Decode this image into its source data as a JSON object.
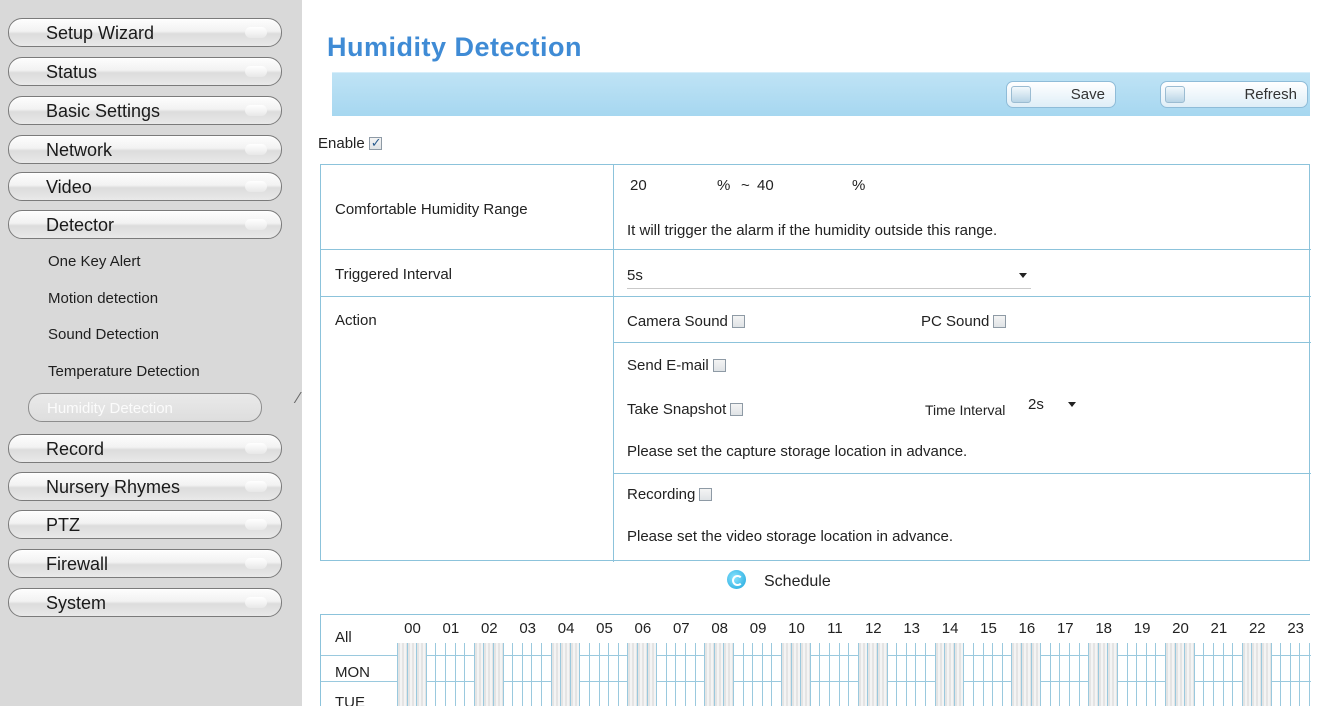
{
  "sidebar": {
    "menu": [
      {
        "label": "Setup Wizard"
      },
      {
        "label": "Status"
      },
      {
        "label": "Basic Settings"
      },
      {
        "label": "Network"
      },
      {
        "label": "Video"
      },
      {
        "label": "Detector"
      },
      {
        "label": "Record"
      },
      {
        "label": "Nursery Rhymes"
      },
      {
        "label": "PTZ"
      },
      {
        "label": "Firewall"
      },
      {
        "label": "System"
      }
    ],
    "detector_sub": [
      {
        "label": "One Key Alert"
      },
      {
        "label": "Motion detection"
      },
      {
        "label": "Sound Detection"
      },
      {
        "label": "Temperature Detection"
      },
      {
        "label": "Humidity Detection"
      }
    ],
    "active_item": "Humidity Detection"
  },
  "page": {
    "title": "Humidity Detection",
    "save_label": "Save",
    "refresh_label": "Refresh",
    "enable_label": "Enable",
    "enable_checked": true
  },
  "humidity": {
    "range_label": "Comfortable Humidity Range",
    "min_value": "20",
    "max_value": "40",
    "unit": "%",
    "separator": "~",
    "range_hint": "It will trigger the alarm if the humidity outside this range."
  },
  "interval": {
    "label": "Triggered Interval",
    "value": "5s"
  },
  "action": {
    "label": "Action",
    "camera_sound": "Camera Sound",
    "pc_sound": "PC Sound",
    "send_email": "Send E-mail",
    "take_snapshot": "Take Snapshot",
    "time_interval_label": "Time Interval",
    "time_interval_value": "2s",
    "snapshot_hint": "Please set the capture storage location in advance.",
    "recording": "Recording",
    "recording_hint": "Please set the video storage location in advance."
  },
  "schedule": {
    "title": "Schedule",
    "all_label": "All",
    "days": [
      "MON",
      "TUE"
    ],
    "hours": [
      "00",
      "01",
      "02",
      "03",
      "04",
      "05",
      "06",
      "07",
      "08",
      "09",
      "10",
      "11",
      "12",
      "13",
      "14",
      "15",
      "16",
      "17",
      "18",
      "19",
      "20",
      "21",
      "22",
      "23"
    ]
  },
  "colors": {
    "title": "#3f8bd5",
    "toolbar": "#a6d7f0",
    "border": "#8cc3db"
  }
}
